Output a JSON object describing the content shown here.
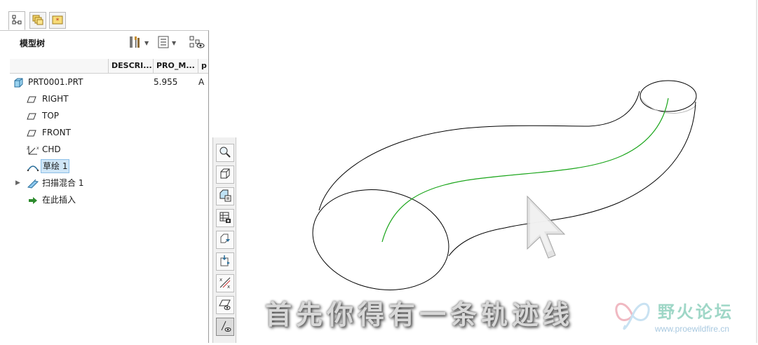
{
  "panel": {
    "title": "模型树",
    "columns": [
      "DESCRI...",
      "PRO_M...",
      "p"
    ]
  },
  "tree": {
    "items": [
      {
        "label": "PRT0001.PRT",
        "icon": "part-icon",
        "value": "5.955",
        "value2": "A"
      },
      {
        "label": "RIGHT",
        "icon": "datum-plane-icon"
      },
      {
        "label": "TOP",
        "icon": "datum-plane-icon"
      },
      {
        "label": "FRONT",
        "icon": "datum-plane-icon"
      },
      {
        "label": "CHD",
        "icon": "coordinate-system-icon"
      },
      {
        "label": "草绘 1",
        "icon": "sketch-icon",
        "selected": true
      },
      {
        "label": "扫描混合 1",
        "icon": "swept-blend-icon"
      },
      {
        "label": "在此插入",
        "icon": "insert-here-arrow-icon"
      }
    ]
  },
  "toolbar": {
    "buttons": [
      "zoom-icon",
      "view-orientation-icon",
      "saved-views-icon",
      "appearance-gallery-icon",
      "datum-display-icon",
      "datum-point-display-icon",
      "axis-display-icon",
      "plane-display-icon",
      "sketch-display-icon"
    ]
  },
  "canvas": {
    "subtitle": "首先你得有一条轨迹线",
    "colors": {
      "edge": "#000000",
      "trajectory": "#1aa51a",
      "hidden_edge": "#b8b8b8"
    }
  },
  "watermark": {
    "title": "野火论坛",
    "url": "www.proewildfire.cn"
  }
}
